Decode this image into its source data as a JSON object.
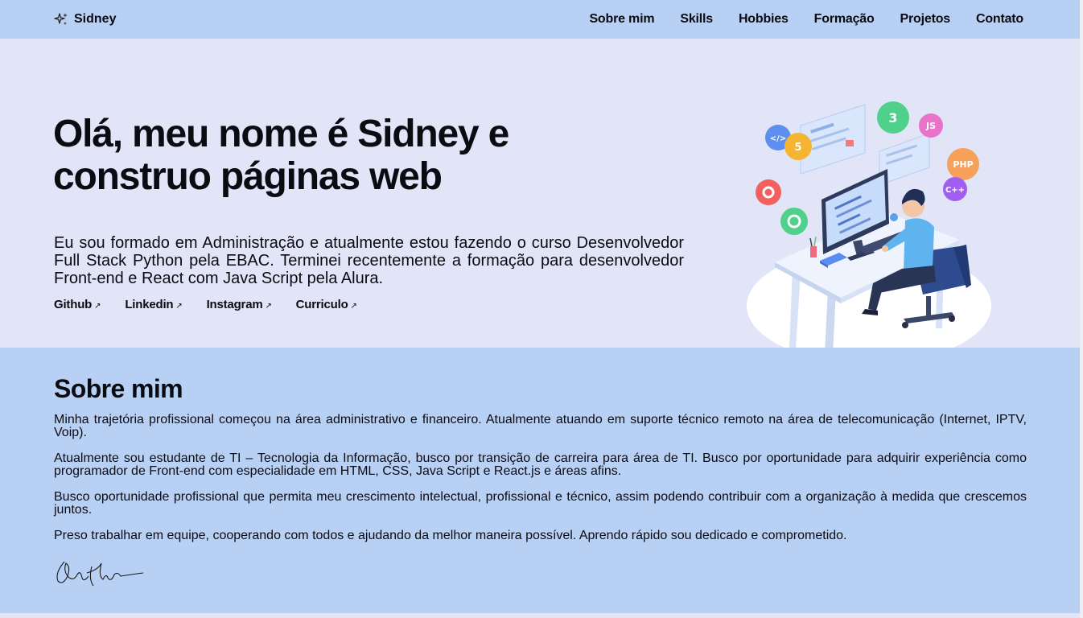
{
  "brand": {
    "name": "Sidney",
    "icon": "sparkles-icon"
  },
  "nav": {
    "items": [
      "Sobre mim",
      "Skills",
      "Hobbies",
      "Formação",
      "Projetos",
      "Contato"
    ]
  },
  "hero": {
    "title": "Olá, meu nome é Sidney e construo páginas web",
    "description": "Eu sou formado em Administração e atualmente estou fazendo o curso Desenvolvedor Full Stack Python pela EBAC. Terminei recentemente a formação para desenvolvedor Front-end e React com Java Script pela Alura.",
    "links": [
      {
        "label": "Github",
        "icon": "external-arrow-icon"
      },
      {
        "label": "Linkedin",
        "icon": "external-arrow-icon"
      },
      {
        "label": "Instagram",
        "icon": "external-arrow-icon"
      },
      {
        "label": "Curriculo",
        "icon": "external-arrow-icon"
      }
    ],
    "illustration": {
      "badges": [
        "</>",
        "5",
        "3",
        "JS",
        "PHP",
        "C++"
      ]
    }
  },
  "about": {
    "title": "Sobre mim",
    "paragraphs": [
      "Minha trajetória profissional começou na área administrativo e financeiro. Atualmente atuando em suporte técnico remoto na área de telecomunicação (Internet, IPTV, Voip).",
      "Atualmente sou estudante de TI – Tecnologia da Informação, busco por transição de carreira para área de TI. Busco por oportunidade para adquirir experiência como programador de Front-end com especialidade em HTML, CSS, Java Script e React.js e áreas afins.",
      "Busco oportunidade profissional que permita meu crescimento intelectual, profissional e técnico, assim podendo contribuir com a organização à medida que crescemos juntos.",
      "Preso trabalhar em equipe, cooperando com todos e ajudando da melhor maneira possível. Aprendo rápido sou dedicado e comprometido."
    ]
  },
  "colors": {
    "nav_bg": "#b8d0f3",
    "hero_bg": "#e1e5f7",
    "about_bg": "#b8d0f3",
    "text": "#0b0b12"
  }
}
